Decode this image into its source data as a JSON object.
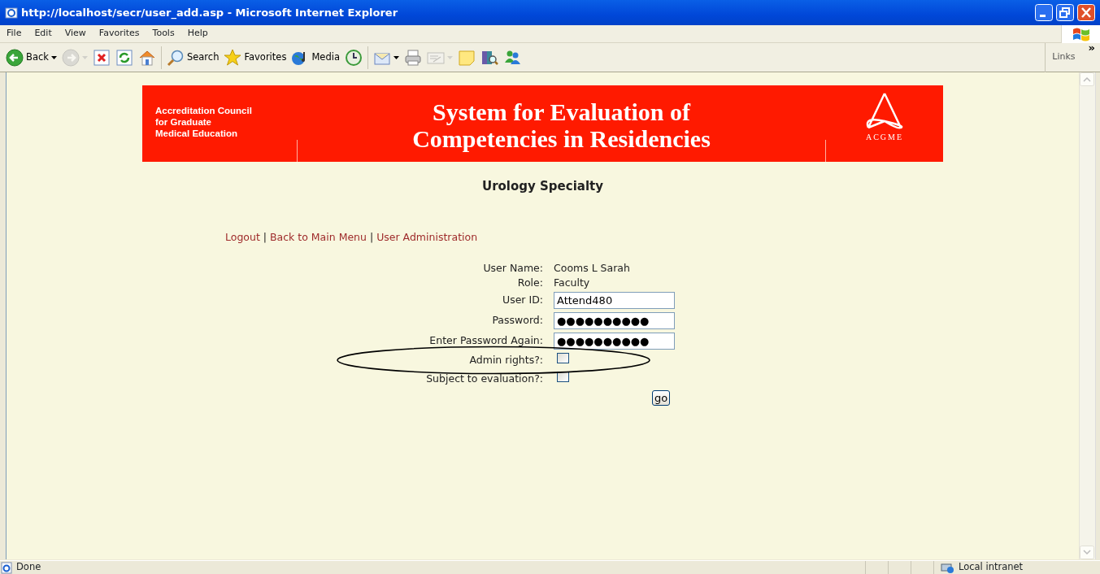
{
  "window": {
    "title": "http://localhost/secr/user_add.asp - Microsoft Internet Explorer"
  },
  "menu": [
    "File",
    "Edit",
    "View",
    "Favorites",
    "Tools",
    "Help"
  ],
  "toolbar": [
    {
      "kind": "back",
      "label": "Back",
      "dropdown": true,
      "disabled": false
    },
    {
      "kind": "forward",
      "dropdown": true,
      "disabled": true
    },
    {
      "kind": "stop",
      "dropdown": false,
      "disabled": false
    },
    {
      "kind": "refresh",
      "dropdown": false,
      "disabled": false
    },
    {
      "kind": "home",
      "dropdown": false,
      "disabled": false
    },
    {
      "kind": "separator"
    },
    {
      "kind": "search",
      "label": "Search",
      "dropdown": false,
      "disabled": false
    },
    {
      "kind": "favorites",
      "label": "Favorites",
      "dropdown": false,
      "disabled": false
    },
    {
      "kind": "media",
      "label": "Media",
      "dropdown": false,
      "disabled": false
    },
    {
      "kind": "history",
      "dropdown": false,
      "disabled": false
    },
    {
      "kind": "separator"
    },
    {
      "kind": "mail",
      "dropdown": true,
      "disabled": false
    },
    {
      "kind": "print",
      "dropdown": false,
      "disabled": false
    },
    {
      "kind": "edit",
      "dropdown": true,
      "disabled": true
    },
    {
      "kind": "note",
      "dropdown": false,
      "disabled": false
    },
    {
      "kind": "research",
      "dropdown": false,
      "disabled": false
    },
    {
      "kind": "messenger",
      "dropdown": false,
      "disabled": false
    }
  ],
  "links_bar": {
    "label": "Links",
    "chevron": "»"
  },
  "banner": {
    "org_lines": [
      "Accreditation Council",
      "for Graduate",
      "Medical Education"
    ],
    "title_lines": [
      "System for Evaluation of",
      "Competencies in Residencies"
    ],
    "logo_text": "ACGME"
  },
  "heading": "Urology Specialty",
  "nav": [
    {
      "label": "Logout"
    },
    {
      "label": "Back to Main Menu"
    },
    {
      "label": "User Administration"
    }
  ],
  "nav_separator": "|",
  "form": [
    {
      "kind": "text",
      "label": "User Name:",
      "value": "Cooms L Sarah"
    },
    {
      "kind": "text",
      "label": "Role:",
      "value": "Faculty"
    },
    {
      "kind": "input",
      "label": "User ID:",
      "value": "Attend480"
    },
    {
      "kind": "input",
      "label": "Password:",
      "value": "●●●●●●●●●●"
    },
    {
      "kind": "input",
      "label": "Enter Password Again:",
      "value": "●●●●●●●●●●"
    },
    {
      "kind": "checkbox",
      "label": "Admin rights?:",
      "checked": false
    },
    {
      "kind": "checkbox",
      "label": "Subject to evaluation?:",
      "checked": false
    }
  ],
  "submit": "go",
  "annotation": {
    "kind": "ellipse"
  },
  "status_bar": {
    "text": "Done",
    "zone": "Local intranet"
  }
}
